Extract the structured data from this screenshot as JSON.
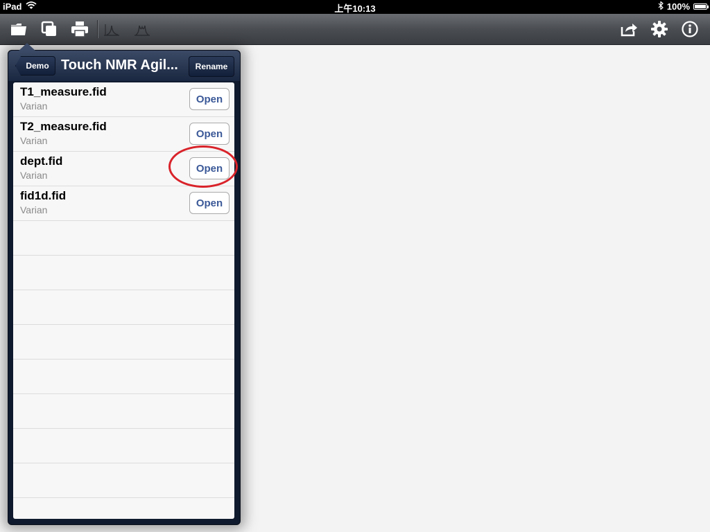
{
  "status_bar": {
    "device": "iPad",
    "time": "上午10:13",
    "battery": "100%"
  },
  "toolbar": {
    "left_icons": [
      "folder-icon",
      "copy-icon",
      "print-icon",
      "peak-icon",
      "multiplet-icon"
    ],
    "right_icons": [
      "share-icon",
      "gear-icon",
      "info-icon"
    ]
  },
  "popover": {
    "back_label": "Demo",
    "title": "Touch NMR Agil...",
    "rename_label": "Rename",
    "files": [
      {
        "name": "T1_measure.fid",
        "vendor": "Varian",
        "action": "Open"
      },
      {
        "name": "T2_measure.fid",
        "vendor": "Varian",
        "action": "Open"
      },
      {
        "name": "dept.fid",
        "vendor": "Varian",
        "action": "Open"
      },
      {
        "name": "fid1d.fid",
        "vendor": "Varian",
        "action": "Open"
      }
    ]
  },
  "colors": {
    "highlight": "#d9232a",
    "open_text": "#3b5998"
  }
}
